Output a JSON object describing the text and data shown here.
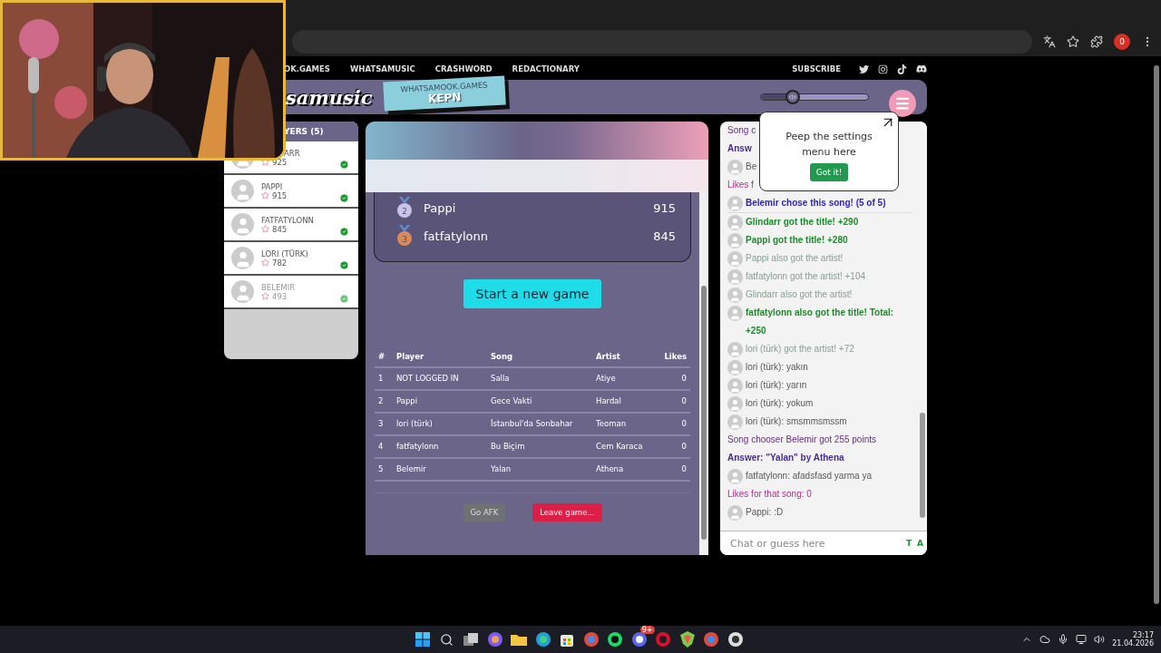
{
  "browser": {
    "profile_badge": "0"
  },
  "nav": {
    "links": [
      "OK.GAMES",
      "WHATSAMUSIC",
      "CRASHWORD",
      "REDACTIONARY"
    ],
    "subscribe": "SUBSCRIBE"
  },
  "header": {
    "logo": "samusic",
    "tag_site": "WHATSAMOOK.GAMES",
    "tag_code": "KEPN",
    "volume": {
      "level": 0.3
    }
  },
  "players": {
    "title": "YERS (5)",
    "items": [
      {
        "name": "ARR",
        "score": "925",
        "ready": true,
        "dimmed": false
      },
      {
        "name": "PAPPI",
        "score": "915",
        "ready": true,
        "dimmed": false
      },
      {
        "name": "FATFATYLONN",
        "score": "845",
        "ready": true,
        "dimmed": false
      },
      {
        "name": "LORI (TÜRK)",
        "score": "782",
        "ready": true,
        "dimmed": false
      },
      {
        "name": "BELEMIR",
        "score": "493",
        "ready": true,
        "dimmed": true
      }
    ]
  },
  "podium": [
    {
      "rank": "2",
      "name": "Pappi",
      "score": "915",
      "color": "#c9c3e8"
    },
    {
      "rank": "3",
      "name": "fatfatylonn",
      "score": "845",
      "color": "#d98a5a"
    }
  ],
  "start_button": "Start a new game",
  "table": {
    "columns": [
      "#",
      "Player",
      "Song",
      "Artist",
      "Likes"
    ],
    "rows": [
      [
        "1",
        "NOT LOGGED IN",
        "Salla",
        "Atiye",
        "0"
      ],
      [
        "2",
        "Pappi",
        "Gece Vakti",
        "Hardal",
        "0"
      ],
      [
        "3",
        "lori (türk)",
        "İstanbul'da Sonbahar",
        "Teoman",
        "0"
      ],
      [
        "4",
        "fatfatylonn",
        "Bu Biçim",
        "Cem Karaca",
        "0"
      ],
      [
        "5",
        "Belemir",
        "Yalan",
        "Athena",
        "0"
      ]
    ]
  },
  "afk_button": "Go AFK",
  "leave_button": "Leave game...",
  "chat": {
    "messages": [
      {
        "kind": "chooser",
        "text": "Song c",
        "avatar": false
      },
      {
        "kind": "answer",
        "text": "Answ",
        "avatar": false
      },
      {
        "kind": "chat",
        "text": "Be",
        "avatar": true
      },
      {
        "kind": "likes",
        "text": "Likes f",
        "avatar": false
      },
      {
        "kind": "announce",
        "text": "Belemir chose this song! (5 of 5)",
        "avatar": true
      },
      {
        "kind": "title",
        "text": "Glindarr got the title! +290",
        "avatar": true
      },
      {
        "kind": "title",
        "text": "Pappi got the title! +280",
        "avatar": true
      },
      {
        "kind": "artist",
        "text": "Pappi also got the artist!",
        "avatar": true
      },
      {
        "kind": "artist",
        "text": "fatfatylonn got the artist! +104",
        "avatar": true
      },
      {
        "kind": "artist",
        "text": "Glindarr also got the artist!",
        "avatar": true
      },
      {
        "kind": "title",
        "text": "fatfatylonn also got the title! Total: +250",
        "avatar": true
      },
      {
        "kind": "artist",
        "text": "lori (türk) got the artist! +72",
        "avatar": true
      },
      {
        "kind": "chat",
        "text": "lori (türk): yakın",
        "avatar": true
      },
      {
        "kind": "chat",
        "text": "lori (türk): yarın",
        "avatar": true
      },
      {
        "kind": "chat",
        "text": "lori (türk): yokum",
        "avatar": true
      },
      {
        "kind": "chat",
        "text": "lori (türk): smsmmsmssm",
        "avatar": true
      },
      {
        "kind": "chooser",
        "text": "Song chooser Belemir got 255 points",
        "avatar": false
      },
      {
        "kind": "answer",
        "text": "Answer: \"Yalan\" by Athena",
        "avatar": false
      },
      {
        "kind": "chat",
        "text": "fatfatylonn: afadsfasd yarma ya",
        "avatar": true
      },
      {
        "kind": "likes",
        "text": "Likes for that song: 0",
        "avatar": false
      },
      {
        "kind": "chat",
        "text": "Pappi: :D",
        "avatar": true
      }
    ],
    "placeholder": "Chat or guess here",
    "tools": [
      "T",
      "A"
    ]
  },
  "popover": {
    "text": "Peep the settings menu here",
    "button": "Got it!"
  },
  "taskbar": {
    "discord_badge": "9+",
    "time": "23:17",
    "date": "21.04.2026"
  }
}
